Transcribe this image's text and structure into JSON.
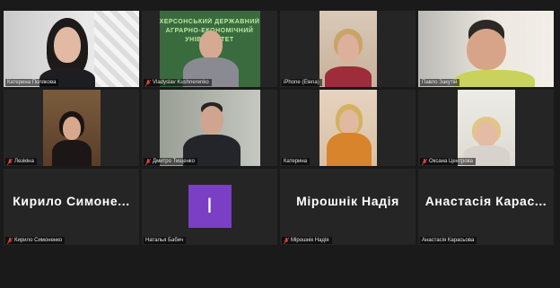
{
  "participants": [
    {
      "name": "Катерина Полякова",
      "muted": false,
      "active": true
    },
    {
      "name": "Vladyslav Kushnerenko",
      "muted": true,
      "banner": "ХЕРСОНСЬКИЙ ДЕРЖАВНИЙ АГРАРНО-ЕКОНОМІЧНИЙ УНІВЕРСИТЕТ"
    },
    {
      "name": "iPhone (Elena)",
      "muted": false
    },
    {
      "name": "Павло Закутій",
      "muted": false
    },
    {
      "name": "Лезікіна",
      "muted": true
    },
    {
      "name": "Дмитро Тищенко",
      "muted": true
    },
    {
      "name": "Катерина",
      "muted": false
    },
    {
      "name": "Оксана Центрова",
      "muted": true
    },
    {
      "name": "Кирило Симоненко",
      "display": "Кирило  Симоне...",
      "muted": true
    },
    {
      "name": "Наталья Бабич",
      "initial": "I",
      "muted": false
    },
    {
      "name": "Мірошнік Надія",
      "display": "Мірошнік Надія",
      "muted": true
    },
    {
      "name": "Анастасія Карасьова",
      "display": "Анастасія  Карас...",
      "muted": false
    }
  ],
  "colors": {
    "active_border": "#d7e44a",
    "avatar_bg": "#7a3fc4",
    "muted_icon": "#e0463a"
  }
}
